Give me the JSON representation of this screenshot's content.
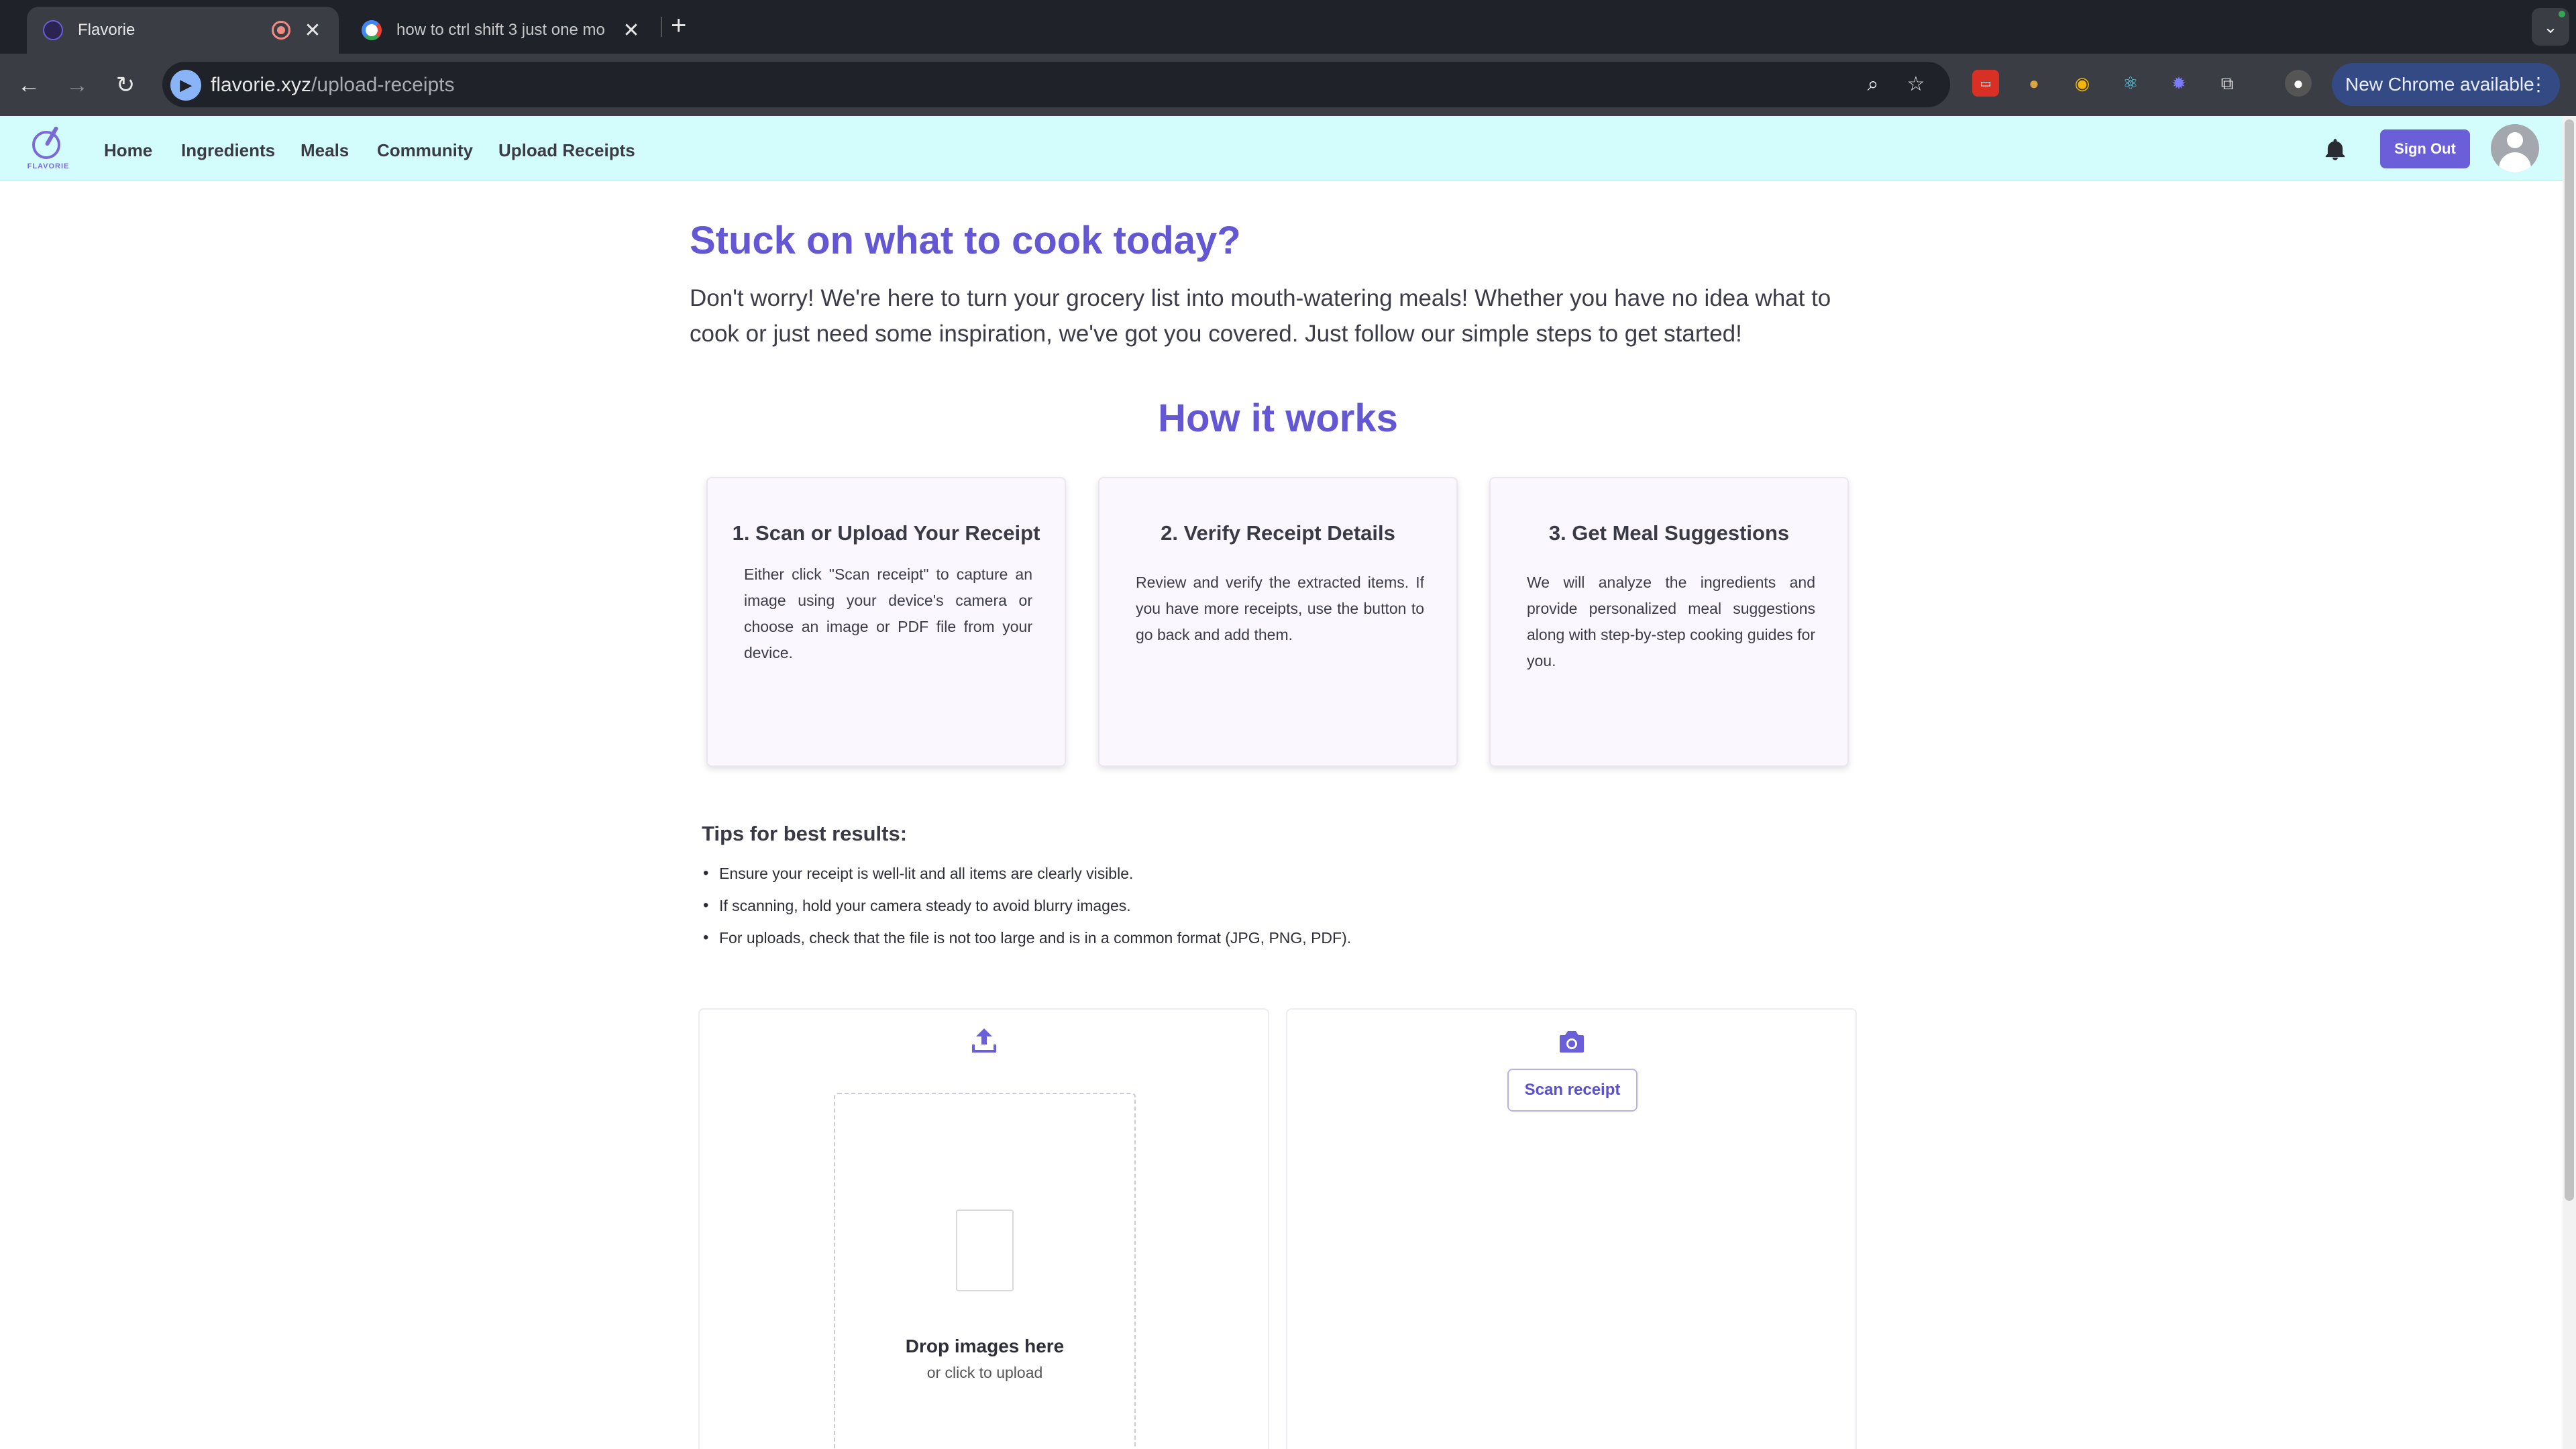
{
  "browser": {
    "tabs": [
      {
        "title": "Flavorie",
        "active": true
      },
      {
        "title": "how to ctrl shift 3 just one mo",
        "active": false
      }
    ],
    "url_host": "flavorie.xyz",
    "url_path": "/upload-receipts",
    "update_button": "New Chrome available",
    "icons": {
      "back": "arrow-left-icon",
      "forward": "arrow-right-icon",
      "reload": "reload-icon",
      "zoom": "zoom-icon",
      "bookmark": "star-icon",
      "extensions": "puzzle-icon"
    },
    "colors": {
      "tab_bg": "#1f2228",
      "toolbar_bg": "#3a3d44",
      "update_button_bg": "#334a85"
    }
  },
  "site": {
    "logo_text": "FLAVORIE",
    "nav": [
      {
        "label": "Home"
      },
      {
        "label": "Ingredients"
      },
      {
        "label": "Meals"
      },
      {
        "label": "Community"
      },
      {
        "label": "Upload Receipts"
      }
    ],
    "sign_out": "Sign Out",
    "colors": {
      "header_bg": "#d3fdfd",
      "accent": "#6457d4",
      "button": "#6a5ed9"
    }
  },
  "hero": {
    "title": "Stuck on what to cook today?",
    "text": "Don't worry! We're here to turn your grocery list into mouth-watering meals! Whether you have no idea what to cook or just need some inspiration, we've got you covered. Just follow our simple steps to get started!"
  },
  "how": {
    "title": "How it works",
    "steps": [
      {
        "title": "1. Scan or Upload Your Receipt",
        "text": "Either click \"Scan receipt\" to capture an image using your device's camera or choose an image or PDF file from your device."
      },
      {
        "title": "2. Verify Receipt Details",
        "text": "Review and verify the extracted items. If you have more receipts, use the button to go back and add them."
      },
      {
        "title": "3. Get Meal Suggestions",
        "text": "We will analyze the ingredients and provide personalized meal suggestions along with step-by-step cooking guides for you."
      }
    ]
  },
  "tips": {
    "title": "Tips for best results:",
    "items": [
      "Ensure your receipt is well-lit and all items are clearly visible.",
      "If scanning, hold your camera steady to avoid blurry images.",
      "For uploads, check that the file is not too large and is in a common format (JPG, PNG, PDF)."
    ]
  },
  "upload": {
    "drop_title": "Drop images here",
    "drop_sub": "or click to upload"
  },
  "scan": {
    "button": "Scan receipt"
  }
}
